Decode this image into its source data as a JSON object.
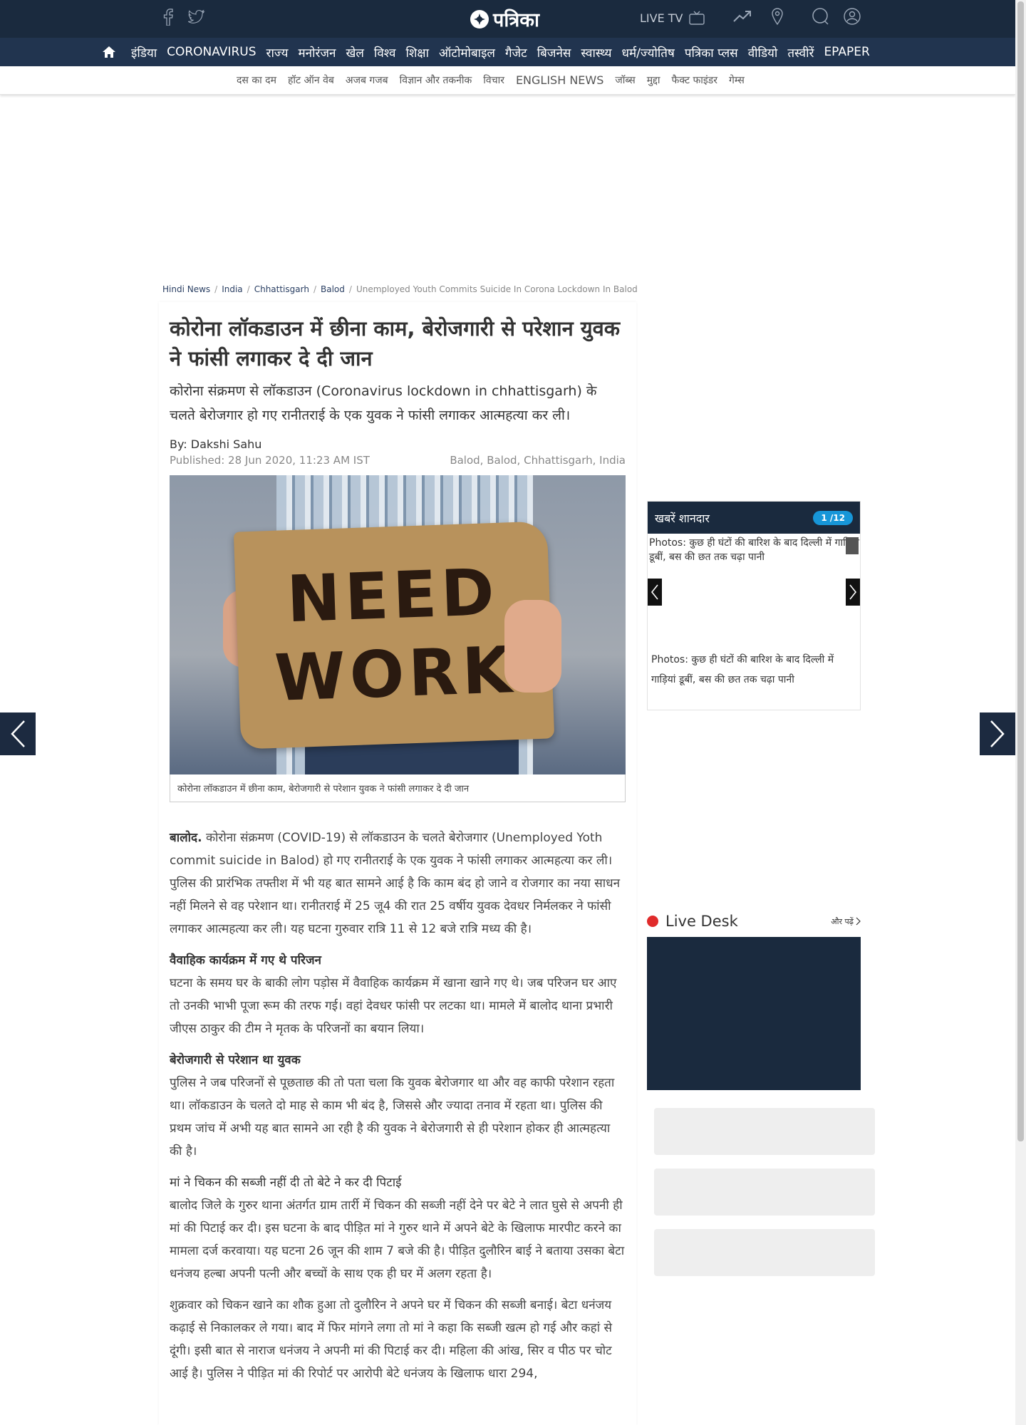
{
  "header": {
    "logo_text": "पत्रिका",
    "live_tv": "LIVE TV",
    "brand_color": "#1a2a3e"
  },
  "main_nav": [
    "इंडिया",
    "CORONAVIRUS",
    "राज्य",
    "मनोरंजन",
    "खेल",
    "विश्व",
    "शिक्षा",
    "ऑटोमोबाइल",
    "गैजेट",
    "बिजनेस",
    "स्वास्थ्य",
    "धर्म/ज्योतिष",
    "पत्रिका प्लस",
    "वीडियो",
    "तस्वीरें",
    "EPAPER"
  ],
  "sub_nav": [
    "दस का दम",
    "हॉट ऑन वेब",
    "अजब गजब",
    "विज्ञान और तकनीक",
    "विचार",
    "ENGLISH NEWS",
    "जॉब्स",
    "मुद्दा",
    "फैक्ट फाइंडर",
    "गेम्स"
  ],
  "breadcrumb": [
    "Hindi News",
    "India",
    "Chhattisgarh",
    "Balod",
    "Unemployed Youth Commits Suicide In Corona Lockdown In Balod"
  ],
  "article": {
    "headline": "कोरोना लॉकडाउन में छीना काम, बेरोजगारी से परेशान युवक ने फांसी लगाकर दे दी जान",
    "summary": "कोरोना संक्रमण से लॉकडाउन (Coronavirus lockdown in chhattisgarh) के चलते बेरोजगार हो गए रानीतराई के एक युवक ने फांसी लगाकर आत्महत्या कर ली।",
    "byline": "By: Dakshi Sahu",
    "published": "Published: 28 Jun 2020, 11:23 AM IST",
    "location": "Balod, Balod, Chhattisgarh, India",
    "image_sign_line1": "NEED",
    "image_sign_line2": "WORK",
    "caption": "कोरोना लॉकडाउन में छीना काम, बेरोजगारी से परेशान युवक ने फांसी लगाकर दे दी जान",
    "dateline": "बालोद.",
    "p1": "कोरोना संक्रमण (COVID-19) से लॉकडाउन के चलते बेरोजगार (Unemployed Yoth commit suicide in Balod) हो गए रानीतराई के एक युवक ने फांसी लगाकर आत्महत्या कर ली। पुलिस की प्रारंभिक तफ्तीश में भी यह बात सामने आई है कि काम बंद हो जाने व रोजगार का नया साधन नहीं मिलने से वह परेशान था। रानीतराई में 25 जू4 की रात 25 वर्षीय युवक देवधर निर्मलकर ने फांसी लगाकर आत्महत्या कर ली। यह घटना गुरुवार रात्रि 11 से 12 बजे रात्रि मध्य की है।",
    "h2": "वैवाहिक कार्यक्रम में गए थे परिजन",
    "p2": "घटना के समय घर के बाकी लोग पड़ोस में वैवाहिक कार्यक्रम में खाना खाने गए थे। जब परिजन घर आए तो उनकी भाभी पूजा रूम की तरफ गई। वहां देवधर फांसी पर लटका था। मामले में बालोद थाना प्रभारी जीएस ठाकुर की टीम ने मृतक के परिजनों का बयान लिया।",
    "h3": "बेरोजगारी से परेशान था युवक",
    "p3": "पुलिस ने जब परिजनों से पूछताछ की तो पता चला कि युवक बेरोजगार था और वह काफी परेशान रहता था। लॉकडाउन के चलते दो माह से काम भी बंद है, जिससे और ज्यादा तनाव में रहता था। पुलिस की प्रथम जांच में अभी यह बात सामने आ रही है की युवक ने बेरोजगारी से ही परेशान होकर ही आत्महत्या की है।",
    "h4": "मां ने चिकन की सब्जी नहीं दी तो बेटे ने कर दी पिटाई",
    "p4": "बालोद जिले के गुरुर थाना अंतर्गत ग्राम तार्री में चिकन की सब्जी नहीं देने पर बेटे ने लात घुसे से अपनी ही मां की पिटाई कर दी। इस घटना के बाद पीड़ित मां ने गुरुर थाने में अपने बेटे के खिलाफ मारपीट करने का मामला दर्ज करवाया। यह घटना 26 जून की शाम 7 बजे की है। पीड़ित दुलौरिन बाई ने बताया उसका बेटा धनंजय हल्बा अपनी पत्नी और बच्चों के साथ एक ही घर में अलग रहता है।",
    "p5": "शुक्रवार को चिकन खाने का शौक हुआ तो दुलौरिन ने अपने घर में चिकन की सब्जी बनाई। बेटा धनंजय कढ़ाई से निकालकर ले गया। बाद में फिर मांगने लगा तो मां ने कहा कि सब्जी खत्म हो गई और कहां से दूंगी। इसी बात से नाराज धनंजय ने अपनी मां की पिटाई कर दी। महिला की आंख, सिर व पीठ पर चोट आई है। पुलिस ने पीड़ित मां की रिपोर्ट पर आरोपी बेटे धनंजय के खिलाफ धारा 294,"
  },
  "widget": {
    "title": "खबरें शानदार",
    "count": "1 /12",
    "image_alt": "Photos: कुछ ही घंटों की बारिश के बाद दिल्ली में गाड़ियां डूबीं, बस की छत तक चढ़ा पानी",
    "caption": "Photos: कुछ ही घंटों की बारिश के बाद दिल्ली में गाड़ियां डूबीं, बस की छत तक चढ़ा पानी"
  },
  "live_desk": {
    "title": "Live Desk",
    "more": "और पढ़ें"
  }
}
